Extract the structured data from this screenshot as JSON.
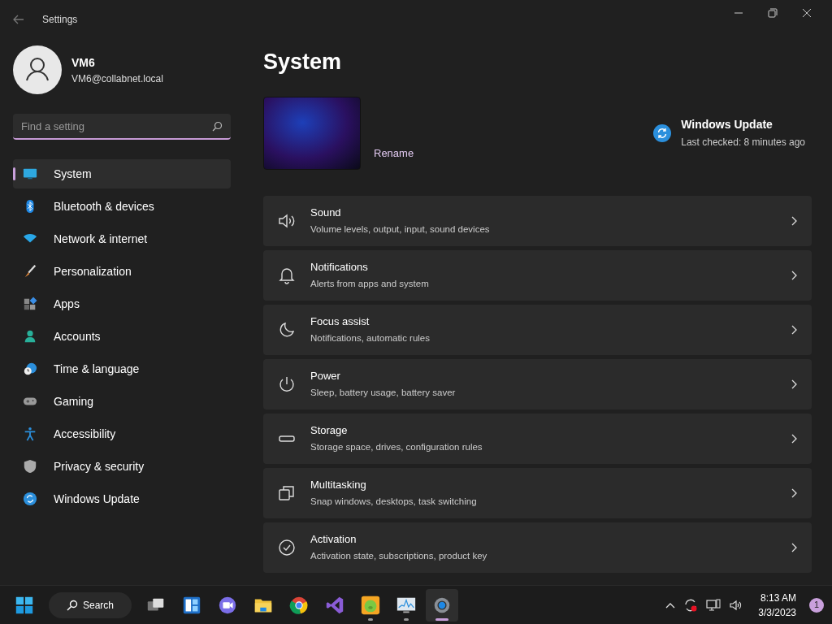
{
  "window": {
    "title": "Settings"
  },
  "user": {
    "name": "VM6",
    "email": "VM6@collabnet.local"
  },
  "search": {
    "placeholder": "Find a setting"
  },
  "sidebar": {
    "items": [
      {
        "label": "System",
        "selected": true
      },
      {
        "label": "Bluetooth & devices",
        "selected": false
      },
      {
        "label": "Network & internet",
        "selected": false
      },
      {
        "label": "Personalization",
        "selected": false
      },
      {
        "label": "Apps",
        "selected": false
      },
      {
        "label": "Accounts",
        "selected": false
      },
      {
        "label": "Time & language",
        "selected": false
      },
      {
        "label": "Gaming",
        "selected": false
      },
      {
        "label": "Accessibility",
        "selected": false
      },
      {
        "label": "Privacy & security",
        "selected": false
      },
      {
        "label": "Windows Update",
        "selected": false
      }
    ]
  },
  "page": {
    "title": "System",
    "rename": "Rename",
    "update": {
      "title": "Windows Update",
      "status": "Last checked: 8 minutes ago"
    },
    "cards": [
      {
        "title": "Sound",
        "subtitle": "Volume levels, output, input, sound devices"
      },
      {
        "title": "Notifications",
        "subtitle": "Alerts from apps and system"
      },
      {
        "title": "Focus assist",
        "subtitle": "Notifications, automatic rules"
      },
      {
        "title": "Power",
        "subtitle": "Sleep, battery usage, battery saver"
      },
      {
        "title": "Storage",
        "subtitle": "Storage space, drives, configuration rules"
      },
      {
        "title": "Multitasking",
        "subtitle": "Snap windows, desktops, task switching"
      },
      {
        "title": "Activation",
        "subtitle": "Activation state, subscriptions, product key"
      }
    ]
  },
  "taskbar": {
    "search_label": "Search",
    "apps": [
      {
        "running": false,
        "active": false
      },
      {
        "running": false,
        "active": false
      },
      {
        "running": false,
        "active": false
      },
      {
        "running": false,
        "active": false
      },
      {
        "running": false,
        "active": false
      },
      {
        "running": false,
        "active": false
      },
      {
        "running": true,
        "active": false
      },
      {
        "running": true,
        "active": false
      },
      {
        "running": true,
        "active": true
      }
    ],
    "time": "8:13 AM",
    "date": "3/3/2023",
    "notification_count": "1"
  }
}
